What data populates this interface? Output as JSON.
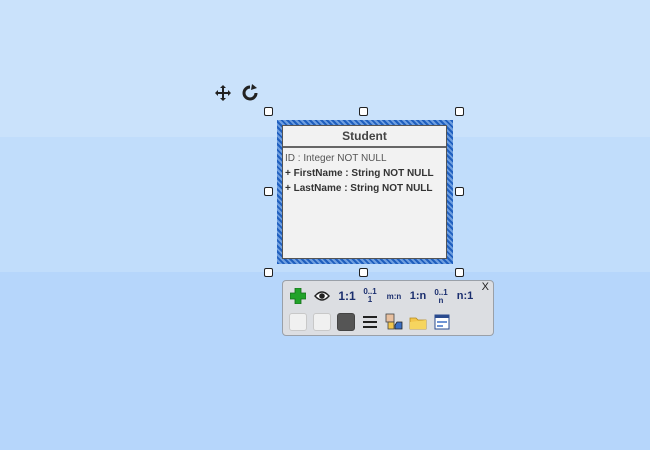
{
  "entity": {
    "title": "Student",
    "attributes": [
      {
        "text": "ID : Integer NOT NULL"
      },
      {
        "text": "+ FirstName : String NOT NULL"
      },
      {
        "text": "+ LastName : String NOT NULL"
      }
    ]
  },
  "toolbar": {
    "close_label": "X",
    "rel_one_one": "1:1",
    "rel_zero_one_one_top": "0..1",
    "rel_zero_one_one_bottom": "1",
    "rel_many_many": "m:n",
    "rel_one_n": "1:n",
    "rel_zero_one_n_top": "0..1",
    "rel_zero_one_n_bottom": "n",
    "rel_n_one": "n:1"
  },
  "colors": {
    "background": "#c1ddfb",
    "selection": "#1f5fbf",
    "add_icon": "#22a32a",
    "relation_text": "#1a2e6e",
    "fill_dark": "#555555",
    "fill_light": "#f0f0f0"
  },
  "icons": [
    "move-icon",
    "rotate-icon",
    "add-attribute-icon",
    "visibility-icon",
    "lines-icon",
    "shapes-icon",
    "folder-icon",
    "window-icon"
  ]
}
